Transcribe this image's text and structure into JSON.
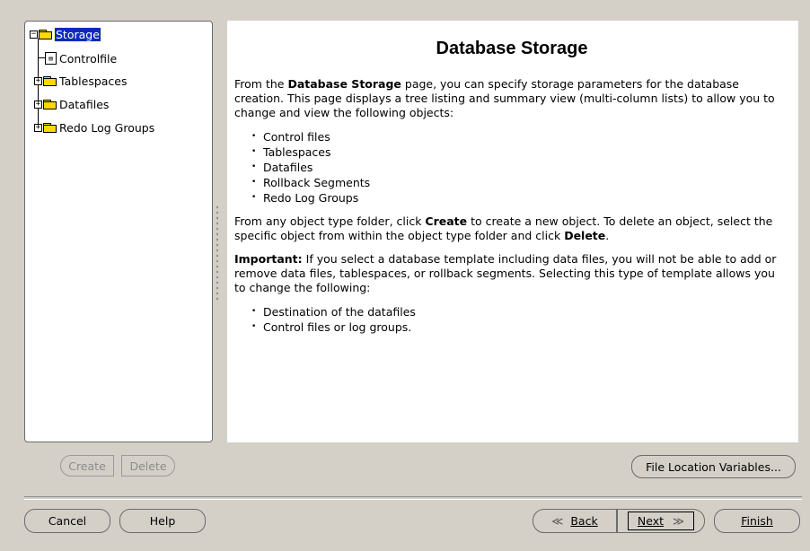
{
  "tree": {
    "root_label": "Storage",
    "items": [
      {
        "label": "Controlfile",
        "icon": "controlfile-icon"
      },
      {
        "label": "Tablespaces",
        "icon": "folder-icon"
      },
      {
        "label": "Datafiles",
        "icon": "folder-icon"
      },
      {
        "label": "Redo Log Groups",
        "icon": "folder-icon"
      }
    ]
  },
  "content": {
    "title": "Database Storage",
    "p1_prefix": "From the ",
    "p1_bold": "Database Storage",
    "p1_suffix": " page, you can specify storage parameters for the database creation. This page displays a tree listing and summary view (multi-column lists) to allow you to change and view the following objects:",
    "list1": [
      "Control files",
      "Tablespaces",
      "Datafiles",
      "Rollback Segments",
      "Redo Log Groups"
    ],
    "p2_a": "From any object type folder, click ",
    "p2_create": "Create",
    "p2_b": " to create a new object. To delete an object, select the specific object from within the object type folder and click ",
    "p2_delete": "Delete",
    "p2_c": ".",
    "p3_bold": "Important:",
    "p3_text": " If you select a database template including data files, you will not be able to add or remove data files, tablespaces, or rollback segments. Selecting this type of template allows you to change the following:",
    "list2": [
      "Destination of the datafiles",
      "Control files or log groups."
    ]
  },
  "buttons": {
    "create": "Create",
    "delete": "Delete",
    "file_location_variables": "File Location Variables...",
    "cancel": "Cancel",
    "help": "Help",
    "back": "Back",
    "next": "Next",
    "finish": "Finish"
  }
}
